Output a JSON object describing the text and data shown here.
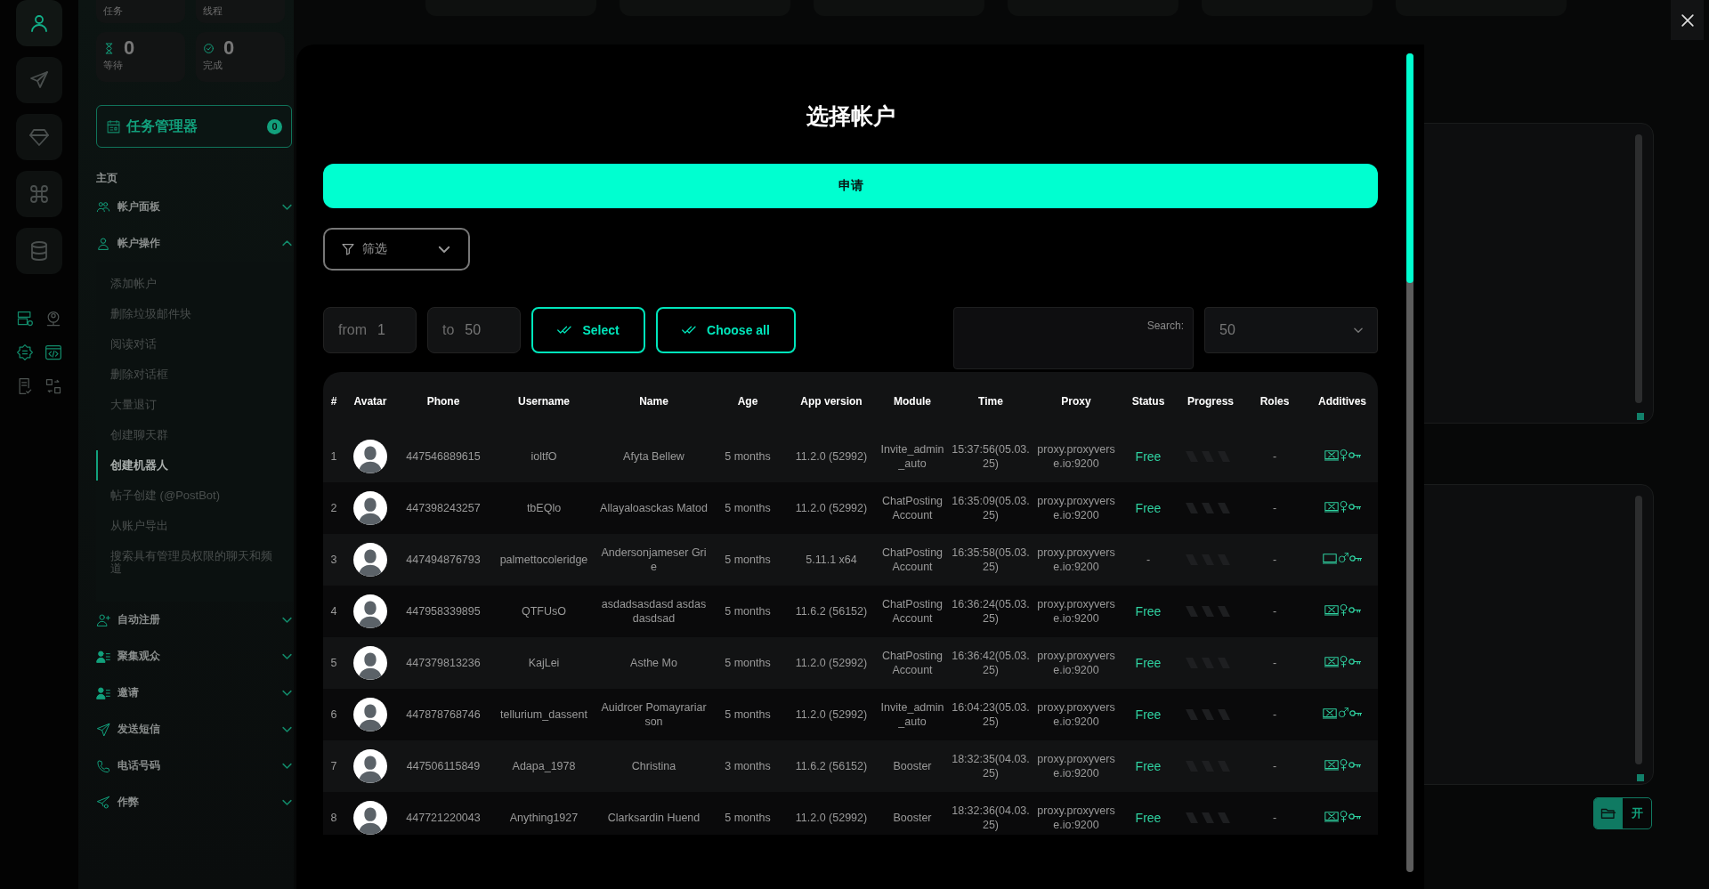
{
  "rail": [
    {
      "kind": "user",
      "selected": true
    },
    {
      "kind": "send",
      "selected": false
    },
    {
      "kind": "diamond",
      "selected": false
    },
    {
      "kind": "command",
      "selected": false
    },
    {
      "kind": "database",
      "selected": false
    }
  ],
  "sidebar": {
    "top_stats": [
      {
        "label": "任务"
      },
      {
        "label": "线程"
      }
    ],
    "stats": [
      {
        "kind": "waiting",
        "value": "0",
        "label": "等待"
      },
      {
        "kind": "done",
        "value": "0",
        "label": "完成"
      }
    ],
    "task_manager": {
      "label": "任务管理器",
      "count": "0"
    },
    "section_title": "主页",
    "groups": [
      {
        "kind": "users",
        "label": "帐户面板",
        "expanded": false
      },
      {
        "kind": "user",
        "label": "帐户操作",
        "expanded": true,
        "children": [
          {
            "label": "添加帐户",
            "selected": false
          },
          {
            "label": "删除垃圾邮件块",
            "selected": false
          },
          {
            "label": "阅读对话",
            "selected": false
          },
          {
            "label": "删除对话框",
            "selected": false
          },
          {
            "label": "大量退订",
            "selected": false
          },
          {
            "label": "创建聊天群",
            "selected": false
          },
          {
            "label": "创建机器人",
            "selected": true
          },
          {
            "label": "帖子创建 (@PostBot)",
            "selected": false
          },
          {
            "label": "从账户导出",
            "selected": false
          },
          {
            "label": "搜索具有管理员权限的聊天和频道",
            "selected": false
          }
        ]
      },
      {
        "kind": "user-add",
        "label": "自动注册",
        "expanded": false
      },
      {
        "kind": "user-list",
        "label": "聚集观众",
        "expanded": false
      },
      {
        "kind": "user-list",
        "label": "邀请",
        "expanded": false
      },
      {
        "kind": "send",
        "label": "发送短信",
        "expanded": false
      },
      {
        "kind": "phone",
        "label": "电话号码",
        "expanded": false
      },
      {
        "kind": "send-gear",
        "label": "作弊",
        "expanded": false
      }
    ]
  },
  "modal": {
    "title": "选择帐户",
    "apply_button": "申请",
    "filter": "筛选",
    "from": {
      "label": "from",
      "value": "1"
    },
    "to": {
      "label": "to",
      "value": "50"
    },
    "select_button": "Select",
    "choose_all_button": "Choose all",
    "search_label": "Search:",
    "page_size": "50",
    "table": {
      "columns": [
        "#",
        "Avatar",
        "Phone",
        "Username",
        "Name",
        "Age",
        "App version",
        "Module",
        "Time",
        "Proxy",
        "Status",
        "Progress",
        "Roles",
        "Additives"
      ],
      "rows": [
        {
          "index": "1",
          "phone": "447546889615",
          "username": "ioltfO",
          "name": "Afyta Bellew",
          "age": "5 months",
          "app_version": "11.2.0 (52992)",
          "module": "Invite_admin_auto",
          "time": "15:37:56(05.03.25)",
          "proxy": "proxy.proxyverse.io:9200",
          "status": "Free",
          "free": true,
          "roles": "-",
          "device_blocked": true,
          "female": true
        },
        {
          "index": "2",
          "phone": "447398243257",
          "username": "tbEQlo",
          "name": "Allayaloasckas Matod",
          "age": "5 months",
          "app_version": "11.2.0 (52992)",
          "module": "ChatPostingAccount",
          "time": "16:35:09(05.03.25)",
          "proxy": "proxy.proxyverse.io:9200",
          "status": "Free",
          "free": true,
          "roles": "-",
          "device_blocked": true,
          "female": true
        },
        {
          "index": "3",
          "phone": "447494876793",
          "username": "palmettocoleridge",
          "name": "Andersonjameser Grie",
          "age": "5 months",
          "app_version": "5.11.1 x64",
          "module": "ChatPostingAccount",
          "time": "16:35:58(05.03.25)",
          "proxy": "proxy.proxyverse.io:9200",
          "status": "-",
          "free": false,
          "roles": "-",
          "device_blocked": false,
          "female": false
        },
        {
          "index": "4",
          "phone": "447958339895",
          "username": "QTFUsO",
          "name": "asdadsasdasd asdasdasdsad",
          "age": "5 months",
          "app_version": "11.6.2 (56152)",
          "module": "ChatPostingAccount",
          "time": "16:36:24(05.03.25)",
          "proxy": "proxy.proxyverse.io:9200",
          "status": "Free",
          "free": true,
          "roles": "-",
          "device_blocked": true,
          "female": true
        },
        {
          "index": "5",
          "phone": "447379813236",
          "username": "KajLei",
          "name": "Asthe Mo",
          "age": "5 months",
          "app_version": "11.2.0 (52992)",
          "module": "ChatPostingAccount",
          "time": "16:36:42(05.03.25)",
          "proxy": "proxy.proxyverse.io:9200",
          "status": "Free",
          "free": true,
          "roles": "-",
          "device_blocked": true,
          "female": true
        },
        {
          "index": "6",
          "phone": "447878768746",
          "username": "tellurium_dassent",
          "name": "Auidrcer Pomayrariarson",
          "age": "5 months",
          "app_version": "11.2.0 (52992)",
          "module": "Invite_admin_auto",
          "time": "16:04:23(05.03.25)",
          "proxy": "proxy.proxyverse.io:9200",
          "status": "Free",
          "free": true,
          "roles": "-",
          "device_blocked": true,
          "female": false
        },
        {
          "index": "7",
          "phone": "447506115849",
          "username": "Adapa_1978",
          "name": "Christina",
          "age": "3 months",
          "app_version": "11.6.2 (56152)",
          "module": "Booster",
          "time": "18:32:35(04.03.25)",
          "proxy": "proxy.proxyverse.io:9200",
          "status": "Free",
          "free": true,
          "roles": "-",
          "device_blocked": true,
          "female": true
        },
        {
          "index": "8",
          "phone": "447721220043",
          "username": "Anything1927",
          "name": "Clarksardin Huend",
          "age": "5 months",
          "app_version": "11.2.0 (52992)",
          "module": "Booster",
          "time": "18:32:36(04.03.25)",
          "proxy": "proxy.proxyverse.io:9200",
          "status": "Free",
          "free": true,
          "roles": "-",
          "device_blocked": true,
          "female": true
        }
      ]
    }
  },
  "open_button": "开"
}
